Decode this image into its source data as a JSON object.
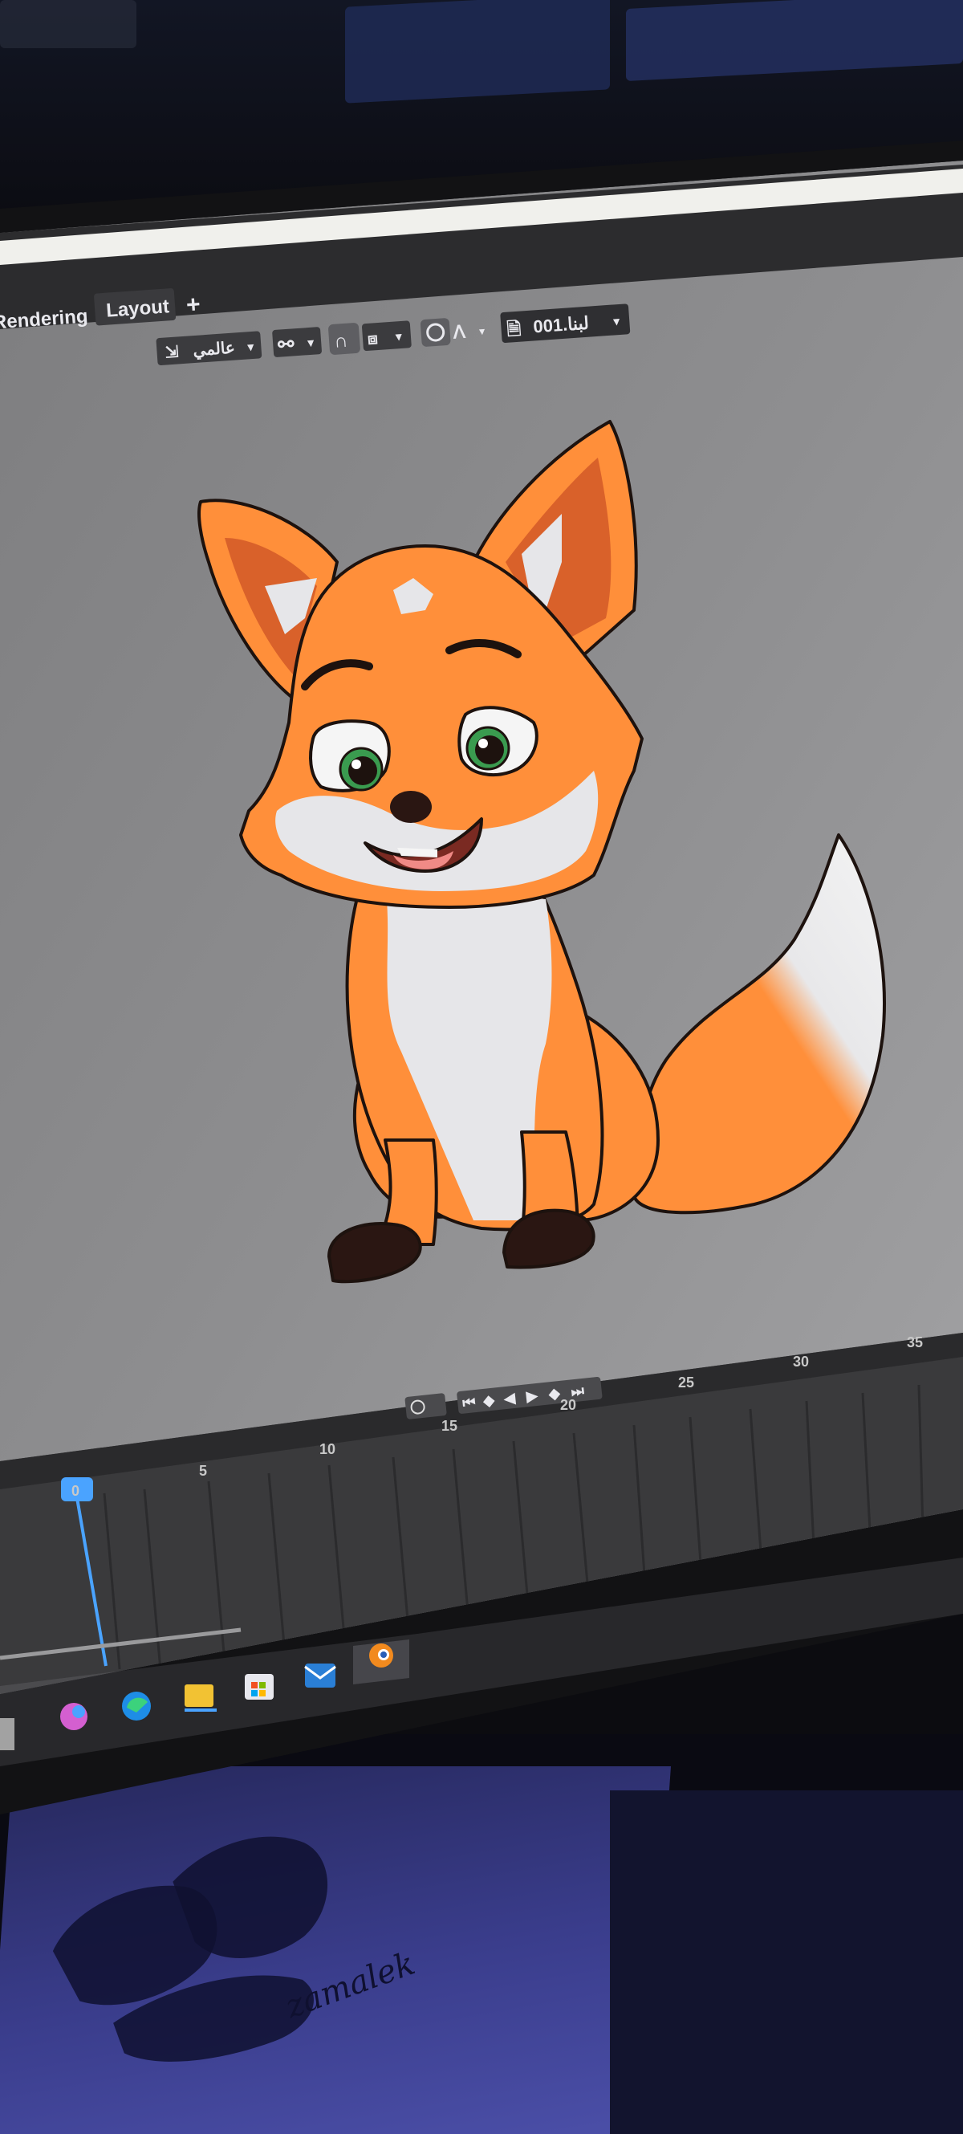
{
  "workspace_tabs": {
    "rendering": "Rendering",
    "layout": "Layout",
    "add": "+"
  },
  "toolbar": {
    "orientation_label": "عالمي",
    "object_name": "لبنا.001"
  },
  "timeline": {
    "current_frame": "0",
    "frame_labels": [
      "5",
      "10",
      "15",
      "20",
      "25",
      "30",
      "35"
    ]
  },
  "colors": {
    "fox_orange": "#ff8f3a",
    "fox_dark_orange": "#e06d2c",
    "fur_white": "#e6e6e9",
    "eye_green": "#3a9b4f",
    "viewport_gray": "#8a8a8a",
    "playhead_blue": "#4aa3ff",
    "tshirt_blue": "#3a3d8c"
  },
  "taskbar": {
    "icons": [
      "copilot-icon",
      "edge-icon",
      "file-explorer-icon",
      "store-icon",
      "mail-icon",
      "blender-icon"
    ]
  },
  "tshirt_print": {
    "text": "zamalek"
  }
}
